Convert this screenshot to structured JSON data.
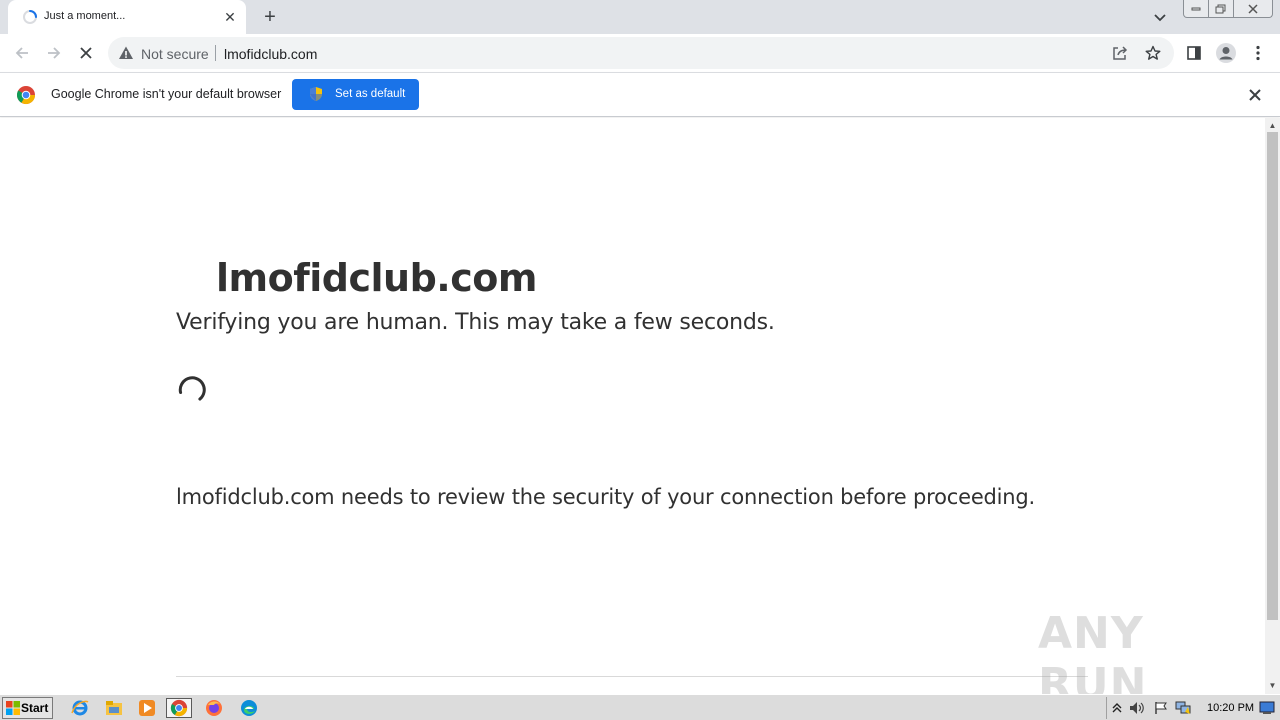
{
  "browser": {
    "tab": {
      "title": "Just a moment...",
      "close": "✕"
    },
    "new_tab": "+",
    "omnibox": {
      "security_label": "Not secure",
      "url": "lmofidclub.com"
    },
    "infobar": {
      "message": "Google Chrome isn't your default browser",
      "button_label": "Set as default",
      "close": "✕"
    },
    "accent_color": "#1a73e8"
  },
  "page": {
    "site_title": "lmofidclub.com",
    "verify_text": "Verifying you are human. This may take a few seconds.",
    "security_text": "lmofidclub.com needs to review the security of your connection before proceeding.",
    "watermark": "ANY RUN"
  },
  "taskbar": {
    "start_label": "Start",
    "apps": [
      "internet-explorer",
      "file-explorer",
      "media-player",
      "chrome",
      "firefox",
      "edge"
    ],
    "active_app": "chrome",
    "clock": "10:20 PM"
  }
}
